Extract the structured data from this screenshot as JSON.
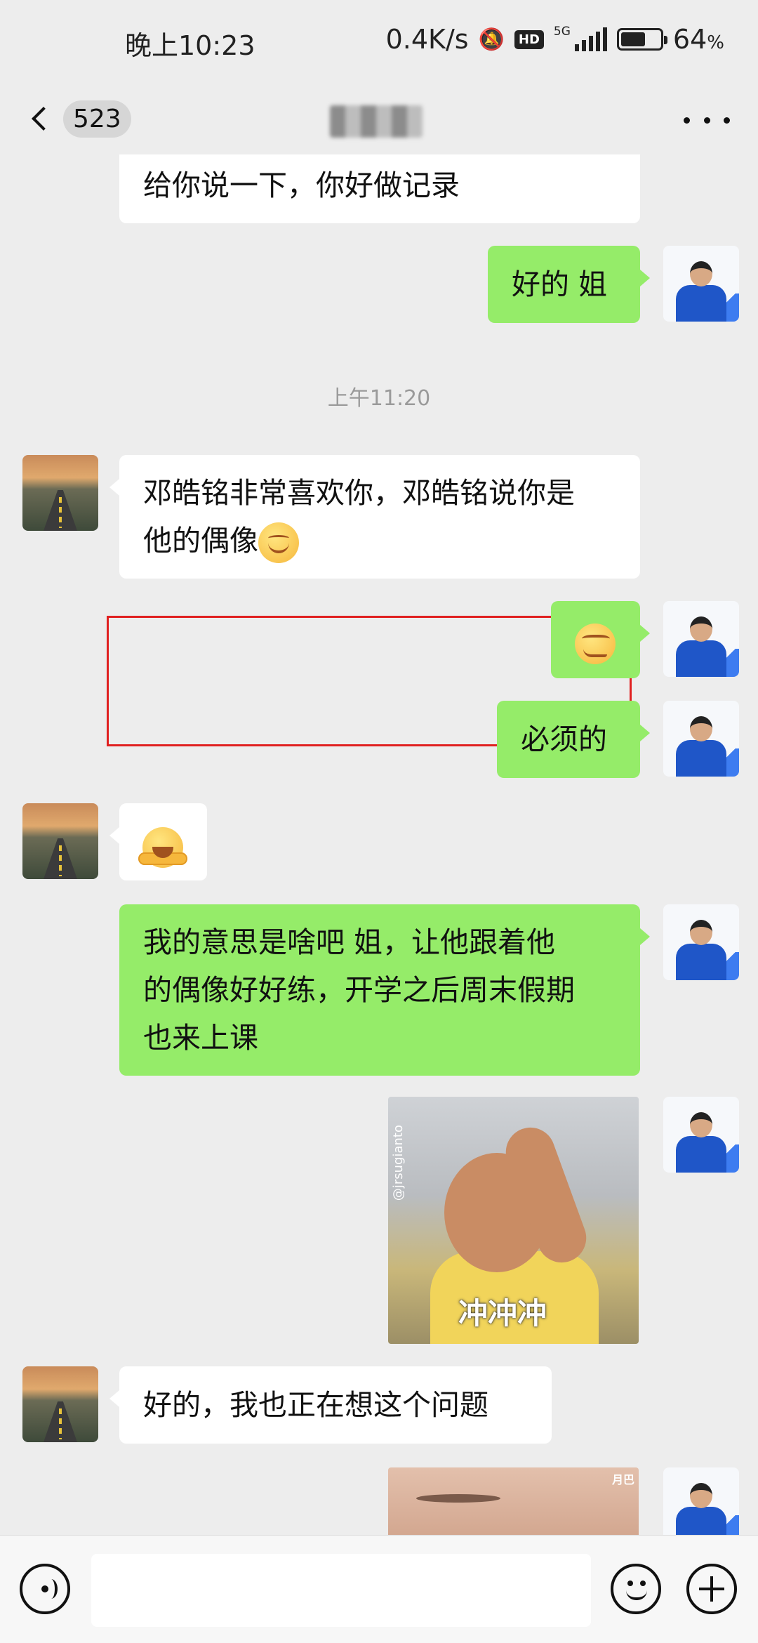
{
  "status_bar": {
    "time": "晚上10:23",
    "network_speed": "0.4K/s",
    "hd_badge": "HD",
    "network_type": "5G",
    "battery_percent_value": "64",
    "battery_percent_unit": "%",
    "battery_level": 0.64
  },
  "nav": {
    "unread_count": "523",
    "chat_title_blurred": true
  },
  "messages": [
    {
      "side": "in",
      "text": "给你说一下，你好做记录"
    },
    {
      "side": "out",
      "text": "好的 姐"
    },
    {
      "type": "timestamp",
      "text": "上午11:20"
    },
    {
      "side": "in",
      "text": "邓皓铭非常喜欢你，邓皓铭说你是他的偶像",
      "emoji": "smiling-face-icon",
      "highlighted": true
    },
    {
      "side": "out",
      "emoji": "smirk-face-icon"
    },
    {
      "side": "out",
      "text": "必须的"
    },
    {
      "side": "in",
      "emoji": "hugging-face-icon"
    },
    {
      "side": "out",
      "text": "我的意思是啥吧 姐，让他跟着他的偶像好好练，开学之后周末假期也来上课"
    },
    {
      "side": "out",
      "type": "sticker",
      "caption": "冲冲冲",
      "watermark": "@jrsugianto"
    },
    {
      "side": "in",
      "text": "好的，我也正在想这个问题"
    },
    {
      "side": "out",
      "type": "sticker",
      "watermark": "月巴"
    }
  ],
  "msg_lines": {
    "m3_line1": "邓皓铭非常喜欢你，邓皓铭说你是",
    "m3_line2": "他的偶像",
    "m7_line1": "我的意思是啥吧 姐，让他跟着他",
    "m7_line2": "的偶像好好练，开学之后周末假期",
    "m7_line3": "也来上课"
  },
  "input": {
    "value": "",
    "placeholder": ""
  },
  "colors": {
    "background": "#ededed",
    "outgoing_bubble": "#95ec69",
    "incoming_bubble": "#ffffff",
    "highlight_box": "#e02020",
    "timestamp_text": "#9a9a9a"
  }
}
